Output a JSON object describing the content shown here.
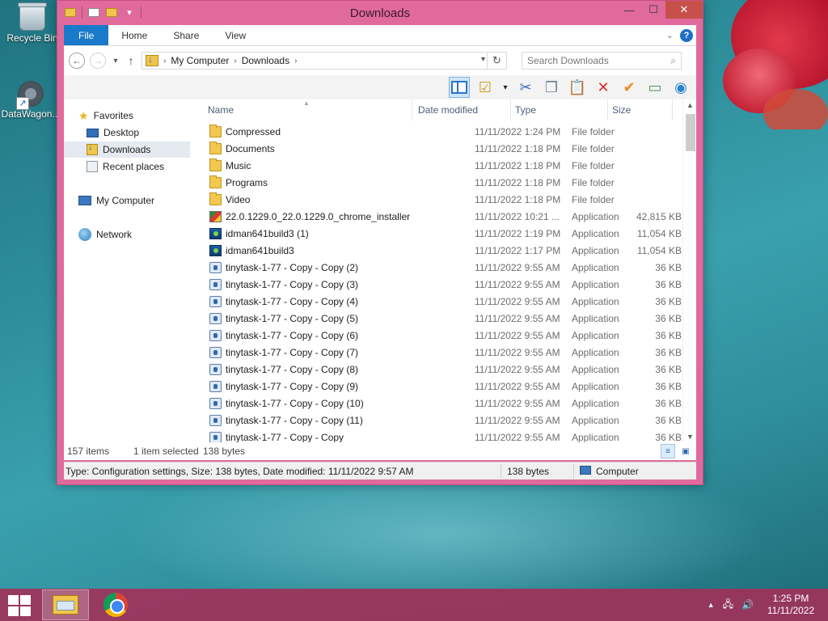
{
  "desktop": {
    "icons": [
      {
        "label": "Recycle Bin",
        "icon": "recycle-bin-icon"
      },
      {
        "label": "DataWagon...",
        "icon": "datawagon-shortcut-icon"
      }
    ]
  },
  "window": {
    "title": "Downloads",
    "controls": {
      "minimize": "—",
      "maximize": "☐",
      "close": "✕"
    }
  },
  "ribbon": {
    "tabs": [
      {
        "label": "File",
        "active": true
      },
      {
        "label": "Home"
      },
      {
        "label": "Share"
      },
      {
        "label": "View"
      }
    ],
    "help": "?"
  },
  "address": {
    "path": [
      "My Computer",
      "Downloads"
    ],
    "search_placeholder": "Search Downloads"
  },
  "toolbar": {
    "buttons": [
      "preview-pane-icon",
      "properties-icon",
      "cut-icon",
      "copy-icon",
      "paste-icon",
      "delete-icon",
      "checkmark-icon",
      "rename-icon",
      "globe-icon"
    ]
  },
  "navigation": {
    "favorites_label": "Favorites",
    "favorites": [
      "Desktop",
      "Downloads",
      "Recent places"
    ],
    "selected": "Downloads",
    "computer_label": "My Computer",
    "network_label": "Network"
  },
  "columns": {
    "name": "Name",
    "date": "Date modified",
    "type": "Type",
    "size": "Size"
  },
  "files": [
    {
      "name": "Compressed",
      "date": "11/11/2022 1:24 PM",
      "type": "File folder",
      "size": "",
      "icon": "folder"
    },
    {
      "name": "Documents",
      "date": "11/11/2022 1:18 PM",
      "type": "File folder",
      "size": "",
      "icon": "folder"
    },
    {
      "name": "Music",
      "date": "11/11/2022 1:18 PM",
      "type": "File folder",
      "size": "",
      "icon": "folder"
    },
    {
      "name": "Programs",
      "date": "11/11/2022 1:18 PM",
      "type": "File folder",
      "size": "",
      "icon": "folder"
    },
    {
      "name": "Video",
      "date": "11/11/2022 1:18 PM",
      "type": "File folder",
      "size": "",
      "icon": "folder"
    },
    {
      "name": "22.0.1229.0_22.0.1229.0_chrome_installer",
      "date": "11/11/2022 10:21 ...",
      "type": "Application",
      "size": "42,815 KB",
      "icon": "installer"
    },
    {
      "name": "idman641build3 (1)",
      "date": "11/11/2022 1:19 PM",
      "type": "Application",
      "size": "11,054 KB",
      "icon": "idm"
    },
    {
      "name": "idman641build3",
      "date": "11/11/2022 1:17 PM",
      "type": "Application",
      "size": "11,054 KB",
      "icon": "idm"
    },
    {
      "name": "tinytask-1-77 - Copy - Copy (2)",
      "date": "11/11/2022 9:55 AM",
      "type": "Application",
      "size": "36 KB",
      "icon": "tiny"
    },
    {
      "name": "tinytask-1-77 - Copy - Copy (3)",
      "date": "11/11/2022 9:55 AM",
      "type": "Application",
      "size": "36 KB",
      "icon": "tiny"
    },
    {
      "name": "tinytask-1-77 - Copy - Copy (4)",
      "date": "11/11/2022 9:55 AM",
      "type": "Application",
      "size": "36 KB",
      "icon": "tiny"
    },
    {
      "name": "tinytask-1-77 - Copy - Copy (5)",
      "date": "11/11/2022 9:55 AM",
      "type": "Application",
      "size": "36 KB",
      "icon": "tiny"
    },
    {
      "name": "tinytask-1-77 - Copy - Copy (6)",
      "date": "11/11/2022 9:55 AM",
      "type": "Application",
      "size": "36 KB",
      "icon": "tiny"
    },
    {
      "name": "tinytask-1-77 - Copy - Copy (7)",
      "date": "11/11/2022 9:55 AM",
      "type": "Application",
      "size": "36 KB",
      "icon": "tiny"
    },
    {
      "name": "tinytask-1-77 - Copy - Copy (8)",
      "date": "11/11/2022 9:55 AM",
      "type": "Application",
      "size": "36 KB",
      "icon": "tiny"
    },
    {
      "name": "tinytask-1-77 - Copy - Copy (9)",
      "date": "11/11/2022 9:55 AM",
      "type": "Application",
      "size": "36 KB",
      "icon": "tiny"
    },
    {
      "name": "tinytask-1-77 - Copy - Copy (10)",
      "date": "11/11/2022 9:55 AM",
      "type": "Application",
      "size": "36 KB",
      "icon": "tiny"
    },
    {
      "name": "tinytask-1-77 - Copy - Copy (11)",
      "date": "11/11/2022 9:55 AM",
      "type": "Application",
      "size": "36 KB",
      "icon": "tiny"
    },
    {
      "name": "tinytask-1-77 - Copy - Copy",
      "date": "11/11/2022 9:55 AM",
      "type": "Application",
      "size": "36 KB",
      "icon": "tiny"
    }
  ],
  "itembar": {
    "count": "157 items",
    "selected": "1 item selected",
    "selected_size": "138 bytes"
  },
  "statusbar": {
    "details": "Type: Configuration settings, Size: 138 bytes, Date modified: 11/11/2022 9:57 AM",
    "size": "138 bytes",
    "location": "Computer"
  },
  "taskbar": {
    "apps": [
      "file-explorer-icon",
      "chrome-icon"
    ],
    "clock_time": "1:25 PM",
    "clock_date": "11/11/2022"
  },
  "colors": {
    "window_frame": "#e16a9c",
    "file_tab": "#1979ca",
    "taskbar": "#a0325a"
  }
}
